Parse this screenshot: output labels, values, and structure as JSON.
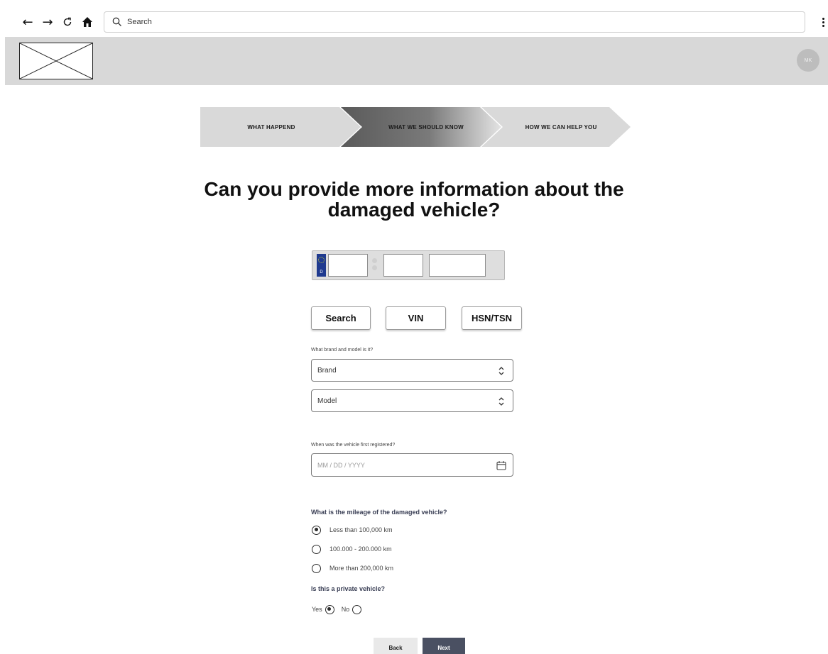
{
  "browser": {
    "back_icon": "back-arrow-icon",
    "forward_icon": "forward-arrow-icon",
    "reload_icon": "reload-icon",
    "home_icon": "home-icon",
    "search_placeholder": "Search",
    "menu_icon": "kebab-menu-icon"
  },
  "header": {
    "logo": "logo-placeholder-image",
    "avatar_initials": "MK"
  },
  "stepper": {
    "steps": [
      {
        "label": "WHAT HAPPEND",
        "state": "done"
      },
      {
        "label": "WHAT WE SHOULD KNOW",
        "state": "active"
      },
      {
        "label": "HOW WE CAN HELP YOU",
        "state": "upcoming"
      }
    ]
  },
  "main": {
    "title": "Can you provide more information about the damaged vehicle?",
    "plate": {
      "country_code": "D",
      "fields": [
        "",
        "",
        ""
      ]
    },
    "lookup_buttons": [
      "Search",
      "VIN",
      "HSN/TSN"
    ],
    "brand_model": {
      "label": "What brand and model is it?",
      "brand_placeholder": "Brand",
      "model_placeholder": "Model"
    },
    "registration": {
      "label": "When was the vehicle first registered?",
      "placeholder": "MM / DD / YYYY"
    },
    "mileage": {
      "label": "What is the mileage of the damaged vehicle?",
      "options": [
        {
          "label": "Less than 100,000 km",
          "selected": true
        },
        {
          "label": "100.000 - 200.000 km",
          "selected": false
        },
        {
          "label": "More than 200,000 km",
          "selected": false
        }
      ]
    },
    "private": {
      "label": "Is this a private vehicle?",
      "yes_label": "Yes",
      "no_label": "No",
      "selected": "Yes"
    },
    "footer": {
      "back_label": "Back",
      "next_label": "Next"
    }
  },
  "colors": {
    "header_bg": "#d8d8d8",
    "step_inactive": "#d9d9d9",
    "step_active_dark": "#5a5a5a",
    "next_button": "#4a5062",
    "plate_eu_blue": "#1f3a8f"
  }
}
